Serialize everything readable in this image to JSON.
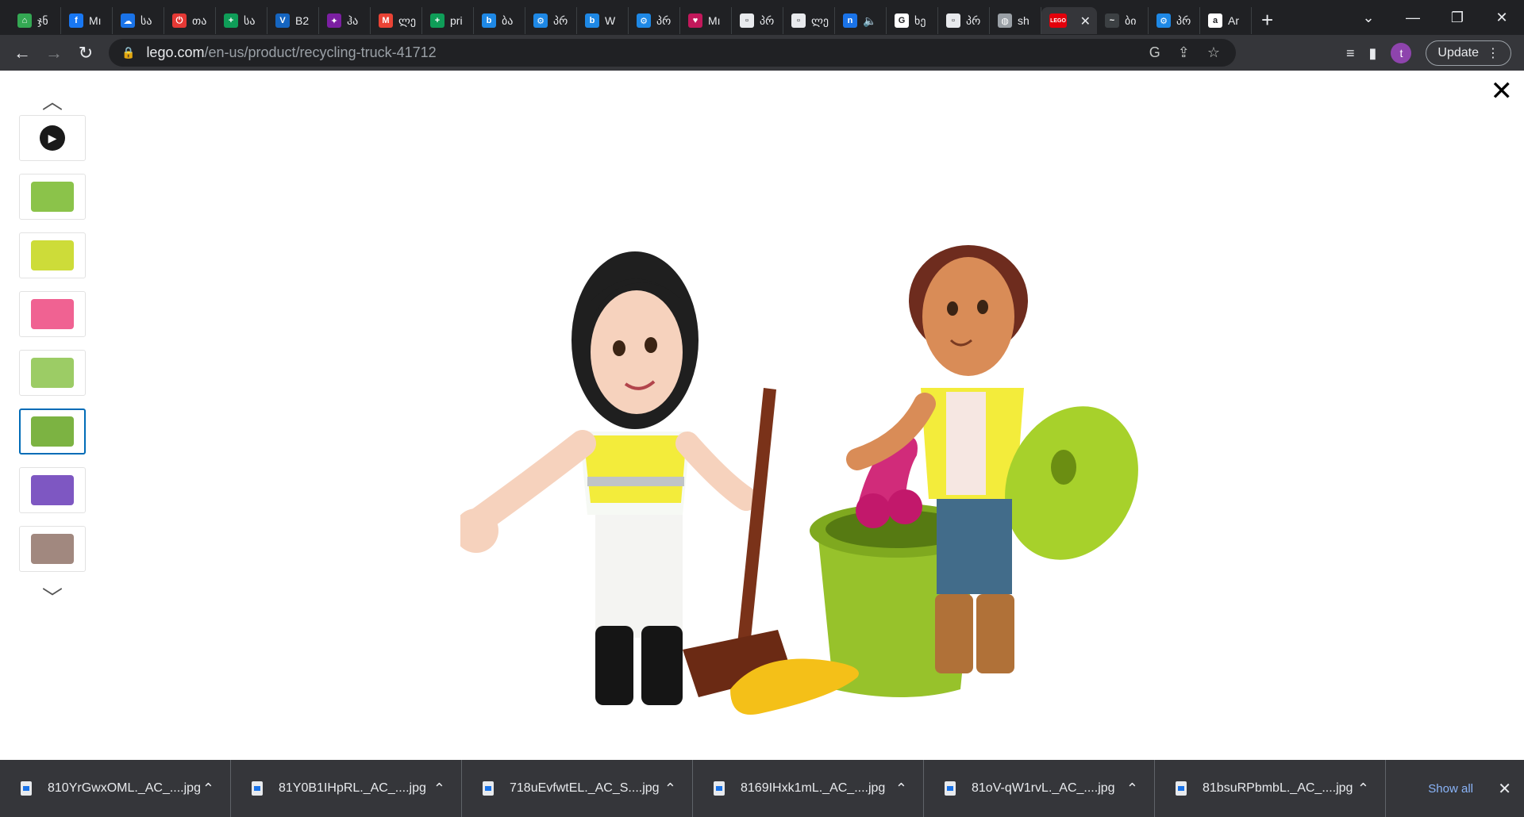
{
  "browser": {
    "tabs": [
      {
        "title": "ჯნ",
        "color": "#34a853",
        "glyph": "⌂"
      },
      {
        "title": "Mı",
        "color": "#1877f2",
        "glyph": "f"
      },
      {
        "title": "სა",
        "color": "#1a73e8",
        "glyph": "☁"
      },
      {
        "title": "თა",
        "color": "#e53935",
        "glyph": "⏻"
      },
      {
        "title": "სა",
        "color": "#0f9d58",
        "glyph": "+"
      },
      {
        "title": "B2",
        "color": "#1565c0",
        "glyph": "V"
      },
      {
        "title": "ჰა",
        "color": "#7b1fa2",
        "glyph": "✦"
      },
      {
        "title": "ლე",
        "color": "#ea4335",
        "glyph": "M"
      },
      {
        "title": "pri",
        "color": "#0f9d58",
        "glyph": "+"
      },
      {
        "title": "ბა",
        "color": "#1e88e5",
        "glyph": "b"
      },
      {
        "title": "პრ",
        "color": "#1e88e5",
        "glyph": "⚙"
      },
      {
        "title": "W",
        "color": "#1e88e5",
        "glyph": "b"
      },
      {
        "title": "პრ",
        "color": "#1e88e5",
        "glyph": "⚙"
      },
      {
        "title": "Mı",
        "color": "#c2185b",
        "glyph": "♥"
      },
      {
        "title": "პრ",
        "color": "#e8eaed",
        "glyph": "▫"
      },
      {
        "title": "ლე",
        "color": "#e8eaed",
        "glyph": "▫"
      },
      {
        "title": "🔈",
        "color": "#1a73e8",
        "glyph": "n"
      },
      {
        "title": "ხე",
        "color": "#ffffff",
        "glyph": "G"
      },
      {
        "title": "პრ",
        "color": "#e8eaed",
        "glyph": "▫"
      },
      {
        "title": "sh",
        "color": "#9aa0a6",
        "glyph": "◍"
      },
      {
        "title": "",
        "color": "#e3000b",
        "glyph": "LEGO",
        "active": true
      },
      {
        "title": "ბი",
        "color": "#3c4043",
        "glyph": "~"
      },
      {
        "title": "პრ",
        "color": "#1e88e5",
        "glyph": "⚙"
      },
      {
        "title": "Ar",
        "color": "#ffffff",
        "glyph": "a"
      }
    ],
    "url_host": "lego.com",
    "url_path": "/en-us/product/recycling-truck-41712",
    "update_label": "Update",
    "profile_initial": "t"
  },
  "gallery": {
    "up_icon": "︿",
    "down_icon": "﹀",
    "close_icon": "✕",
    "thumbnails": [
      {
        "kind": "video"
      },
      {
        "kind": "image",
        "color": "#8bc34a"
      },
      {
        "kind": "image",
        "color": "#cddc39"
      },
      {
        "kind": "image",
        "color": "#f06292"
      },
      {
        "kind": "image",
        "color": "#9ccc65"
      },
      {
        "kind": "image",
        "color": "#7cb342",
        "selected": true
      },
      {
        "kind": "image",
        "color": "#7e57c2"
      },
      {
        "kind": "image",
        "color": "#a1887f"
      }
    ]
  },
  "downloads": {
    "files": [
      "810YrGwxOML._AC_....jpg",
      "81Y0B1IHpRL._AC_....jpg",
      "718uEvfwtEL._AC_S....jpg",
      "8169IHxk1mL._AC_....jpg",
      "81oV-qW1rvL._AC_....jpg",
      "81bsuRPbmbL._AC_....jpg"
    ],
    "show_all_label": "Show all"
  }
}
